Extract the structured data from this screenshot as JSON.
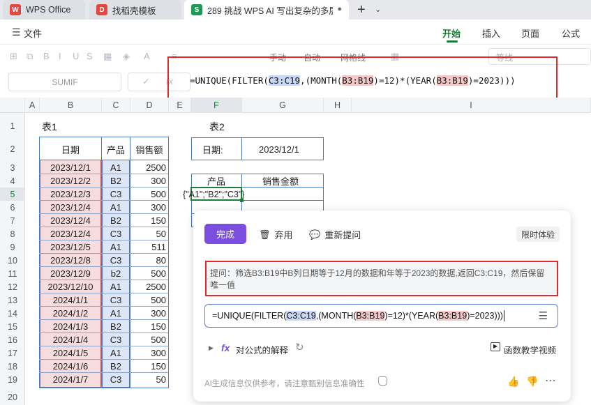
{
  "tabs": [
    {
      "label": "WPS Office",
      "icon": "wps-logo-icon"
    },
    {
      "label": "找稻壳模板",
      "icon": "docer-icon"
    },
    {
      "label": "289 挑战 WPS AI 写出复杂的多层",
      "icon": "sheet-s-icon",
      "icon_text": "S"
    }
  ],
  "menu": {
    "file": "文件",
    "tabs": [
      "开始",
      "插入",
      "页面",
      "公式"
    ],
    "active": "开始"
  },
  "toolbar": {
    "auto1": "手动",
    "auto2": "自动",
    "gridlines": "网格线",
    "font": "等线"
  },
  "formula_bar": {
    "name_box": "SUMIF",
    "formula_parts": [
      "=UNIQUE(FILTER(",
      "C3:C19",
      ",(MONTH(",
      "B3:B19",
      ")=12)*(YEAR(",
      "B3:B19",
      ")=2023)))"
    ]
  },
  "columns": [
    "A",
    "B",
    "C",
    "D",
    "E",
    "F",
    "G",
    "H",
    "I"
  ],
  "rows": [
    "1",
    "2",
    "3",
    "4",
    "5",
    "6",
    "7",
    "8",
    "9",
    "10",
    "11",
    "12",
    "13",
    "14",
    "15",
    "16",
    "17",
    "18",
    "19",
    "20"
  ],
  "table1": {
    "title": "表1",
    "headers": [
      "日期",
      "产品",
      "销售额"
    ],
    "rows": [
      [
        "2023/12/1",
        "A1",
        "2500"
      ],
      [
        "2023/12/2",
        "B2",
        "300"
      ],
      [
        "2023/12/3",
        "C3",
        "500"
      ],
      [
        "2023/12/4",
        "A1",
        "300"
      ],
      [
        "2023/12/4",
        "B2",
        "150"
      ],
      [
        "2023/12/4",
        "C3",
        "50"
      ],
      [
        "2023/12/5",
        "A1",
        "511"
      ],
      [
        "2023/12/8",
        "C3",
        "80"
      ],
      [
        "2023/12/9",
        "b2",
        "500"
      ],
      [
        "2023/12/10",
        "A1",
        "2500"
      ],
      [
        "2024/1/1",
        "C3",
        "500"
      ],
      [
        "2024/1/2",
        "A1",
        "300"
      ],
      [
        "2024/1/3",
        "B2",
        "150"
      ],
      [
        "2024/1/4",
        "C3",
        "500"
      ],
      [
        "2024/1/5",
        "A1",
        "300"
      ],
      [
        "2024/1/6",
        "B2",
        "150"
      ],
      [
        "2024/1/7",
        "C3",
        "50"
      ]
    ]
  },
  "table2": {
    "title": "表2",
    "date_label": "日期:",
    "date_value": "2023/12/1",
    "headers": [
      "产品",
      "销售金额"
    ],
    "preview": "{\"A1\";\"B2\";\"C3\"}"
  },
  "ai_panel": {
    "done": "完成",
    "discard": "弃用",
    "reask": "重新提问",
    "badge": "限时体验",
    "prompt": "提问：筛选B3:B19中B列日期等于12月的数据和年等于2023的数据,返回C3:C19，然后保留唯一值",
    "formula_parts": [
      "=UNIQUE(FILTER(",
      "C3:C19",
      ",(MONTH(",
      "B3:B19",
      ")=12)*(YEAR(",
      "B3:B19",
      ")=2023)))"
    ],
    "explain": "对公式的解释",
    "video": "函数教学视频",
    "footer": "AI生成信息仅供参考，请注意甄别信息准确性"
  }
}
